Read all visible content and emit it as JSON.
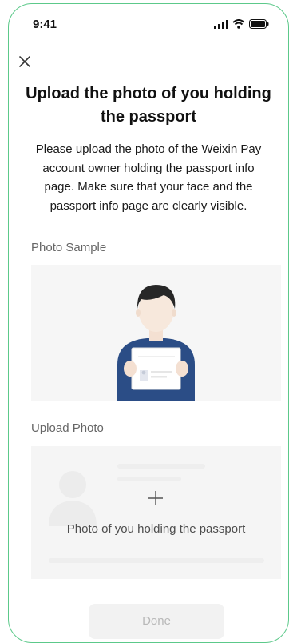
{
  "status_bar": {
    "time": "9:41"
  },
  "icons": {
    "close": "close-icon",
    "signal": "signal-icon",
    "wifi": "wifi-icon",
    "battery": "battery-icon",
    "plus": "plus-icon"
  },
  "title": "Upload the photo of you holding the passport",
  "description": "Please upload the photo of the Weixin Pay account owner holding the passport info page. Make sure that your face and the passport info page are clearly visible.",
  "photo_sample": {
    "label": "Photo Sample"
  },
  "upload_photo": {
    "label": "Upload Photo",
    "placeholder_text": "Photo of you holding the passport"
  },
  "done_button": {
    "label": "Done"
  },
  "colors": {
    "accent_border": "#5cc98a",
    "title_text": "#111111",
    "disabled_button_bg": "#f2f2f2",
    "disabled_button_text": "#b8b8b8"
  }
}
